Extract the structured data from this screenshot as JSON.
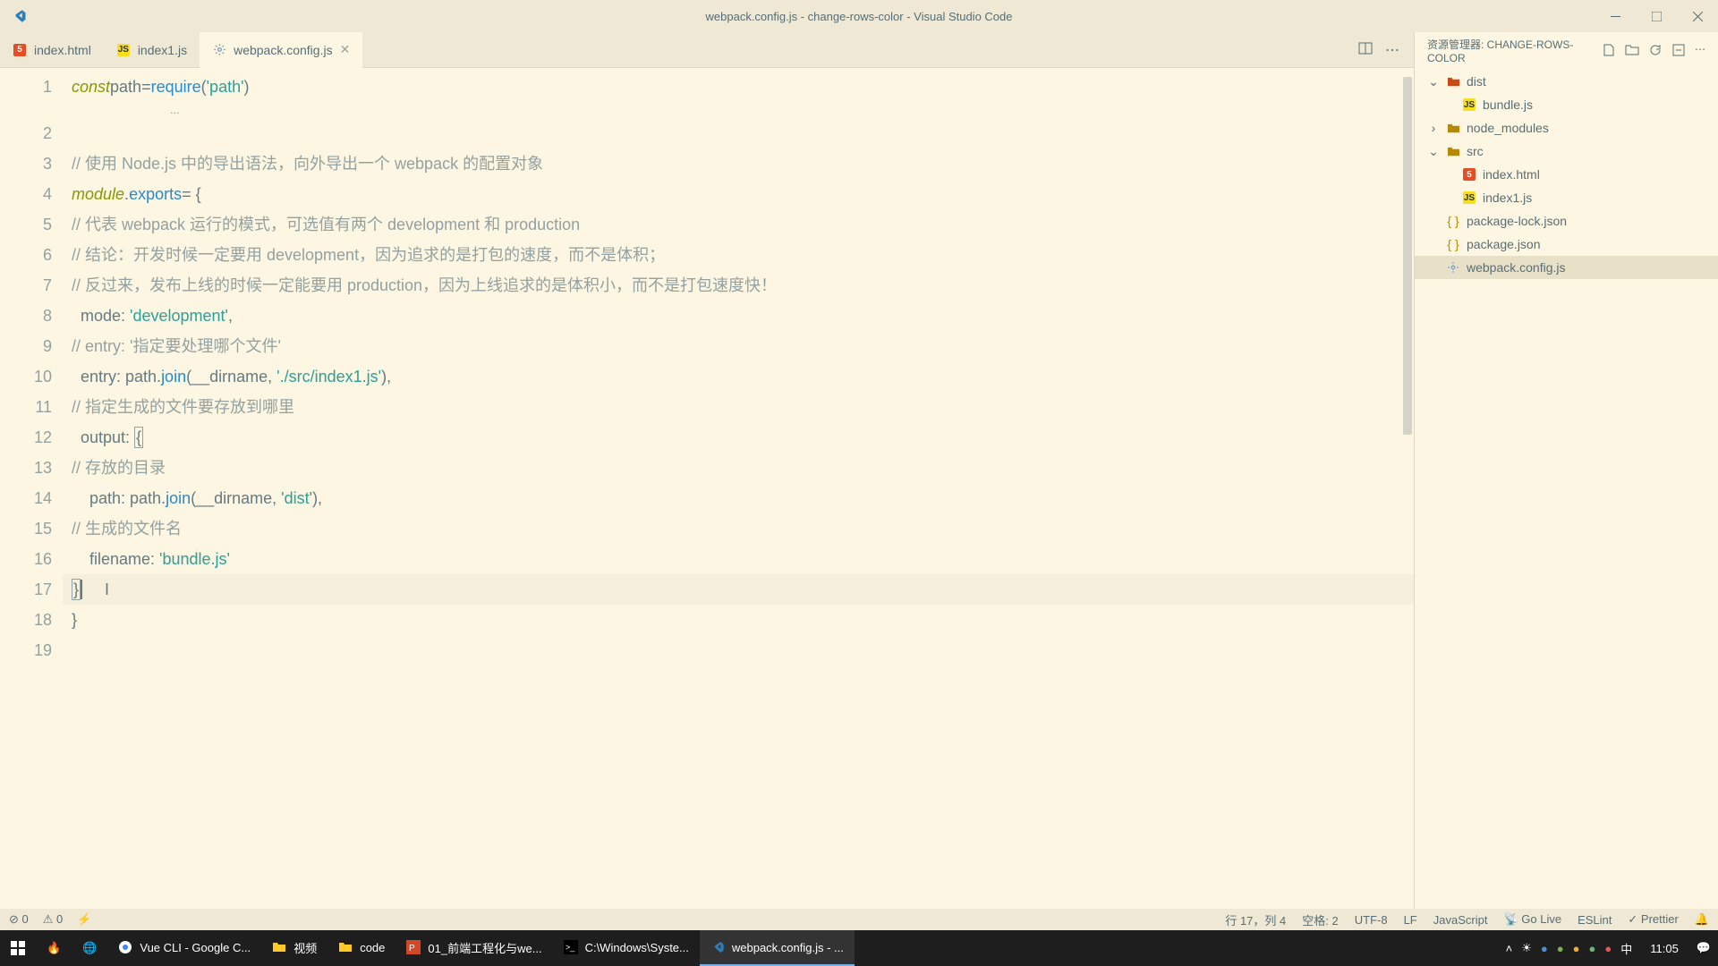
{
  "window": {
    "title": "webpack.config.js - change-rows-color - Visual Studio Code"
  },
  "tabs": [
    {
      "label": "index.html",
      "icon": "html"
    },
    {
      "label": "index1.js",
      "icon": "js"
    },
    {
      "label": "webpack.config.js",
      "icon": "settings",
      "active": true
    }
  ],
  "code": {
    "lines": [
      {
        "n": 1,
        "html": "<span class='tok-kw'>const</span> <span class='tok-var'>path</span> <span class='tok-op'>=</span> <span class='tok-fn'>require</span>(<span class='tok-str'>'path'</span>)"
      },
      {
        "n": "",
        "html": "<span class='tok-com' style='padding-left:110px'>...</span>",
        "thin": true
      },
      {
        "n": 2,
        "html": ""
      },
      {
        "n": 3,
        "html": "<span class='tok-com'>// 使用 Node.js 中的导出语法，向外导出一个 webpack 的配置对象</span>"
      },
      {
        "n": 4,
        "html": "<span class='tok-kw'>module</span>.<span class='tok-prop'>exports</span> <span class='tok-op'>=</span> {"
      },
      {
        "n": 5,
        "html": "  <span class='tok-com'>// 代表 webpack 运行的模式，可选值有两个 development 和 production</span>"
      },
      {
        "n": 6,
        "html": "  <span class='tok-com'>// 结论：开发时候一定要用 development，因为追求的是打包的速度，而不是体积；</span>"
      },
      {
        "n": 7,
        "html": "  <span class='tok-com'>// 反过来，发布上线的时候一定能要用 production，因为上线追求的是体积小，而不是打包速度快！</span>"
      },
      {
        "n": 8,
        "html": "  mode: <span class='tok-str'>'development'</span>,"
      },
      {
        "n": 9,
        "html": "  <span class='tok-com'>// entry: '指定要处理哪个文件'</span>"
      },
      {
        "n": 10,
        "html": "  entry: path.<span class='tok-fn'>join</span>(__dirname, <span class='tok-str'>'./src/index1.js'</span>),"
      },
      {
        "n": 11,
        "html": "  <span class='tok-com'>// 指定生成的文件要存放到哪里</span>"
      },
      {
        "n": 12,
        "html": "  output: <span class='bracket-match'>{</span>"
      },
      {
        "n": 13,
        "html": "    <span class='tok-com'>// 存放的目录</span>"
      },
      {
        "n": 14,
        "html": "    path: path.<span class='tok-fn'>join</span>(__dirname, <span class='tok-str'>'dist'</span>),"
      },
      {
        "n": 15,
        "html": "    <span class='tok-com'>// 生成的文件名</span>"
      },
      {
        "n": 16,
        "html": "    filename: <span class='tok-str'>'bundle.js'</span>"
      },
      {
        "n": 17,
        "html": "  <span class='bracket-match'>}</span><span class='cursor'></span>     I",
        "hl": true
      },
      {
        "n": 18,
        "html": "}"
      },
      {
        "n": 19,
        "html": ""
      }
    ]
  },
  "explorer": {
    "title": "资源管理器: CHANGE-ROWS-COLOR",
    "tree": [
      {
        "type": "folder",
        "open": true,
        "name": "dist",
        "indent": 0,
        "color": "red"
      },
      {
        "type": "file",
        "name": "bundle.js",
        "icon": "js",
        "indent": 1
      },
      {
        "type": "folder",
        "open": false,
        "name": "node_modules",
        "indent": 0
      },
      {
        "type": "folder",
        "open": true,
        "name": "src",
        "indent": 0
      },
      {
        "type": "file",
        "name": "index.html",
        "icon": "html",
        "indent": 1
      },
      {
        "type": "file",
        "name": "index1.js",
        "icon": "js",
        "indent": 1
      },
      {
        "type": "file",
        "name": "package-lock.json",
        "icon": "json",
        "indent": 0
      },
      {
        "type": "file",
        "name": "package.json",
        "icon": "json",
        "indent": 0
      },
      {
        "type": "file",
        "name": "webpack.config.js",
        "icon": "settings",
        "indent": 0,
        "selected": true
      }
    ]
  },
  "statusbar": {
    "errors": "0",
    "warnings": "0",
    "line_col": "行 17，列 4",
    "spaces": "空格: 2",
    "encoding": "UTF-8",
    "eol": "LF",
    "lang": "JavaScript",
    "golive": "Go Live",
    "eslint": "ESLint",
    "prettier": "Prettier"
  },
  "taskbar": {
    "items": [
      {
        "label": "Vue CLI - Google C...",
        "icon": "chrome"
      },
      {
        "label": "视频",
        "icon": "folder"
      },
      {
        "label": "code",
        "icon": "folder"
      },
      {
        "label": "01_前端工程化与we...",
        "icon": "ppt"
      },
      {
        "label": "C:\\Windows\\Syste...",
        "icon": "cmd"
      },
      {
        "label": "webpack.config.js - ...",
        "icon": "vscode",
        "active": true
      }
    ],
    "ime": "中",
    "time": "11:05"
  }
}
